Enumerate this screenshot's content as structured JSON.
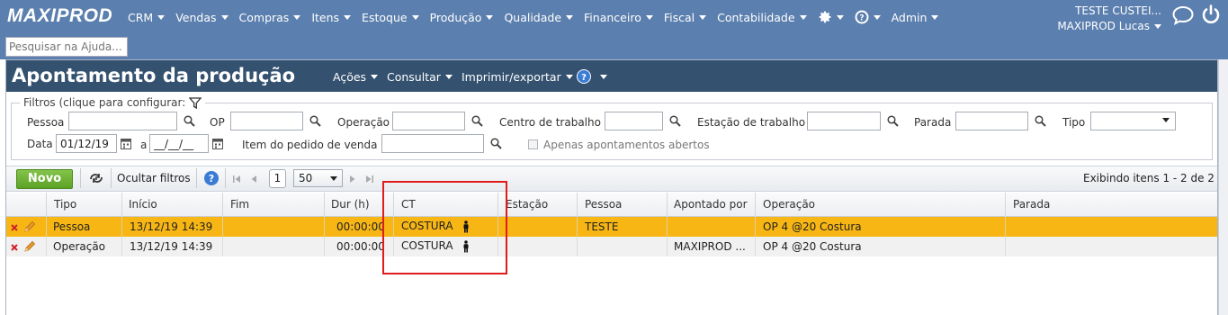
{
  "app": {
    "logo": "MAXIPROD",
    "nav": [
      "CRM",
      "Vendas",
      "Compras",
      "Itens",
      "Estoque",
      "Produção",
      "Qualidade",
      "Financeiro",
      "Fiscal",
      "Contabilidade",
      "Admin"
    ],
    "company": "TESTE CUSTEI...",
    "user": "MAXIPROD Lucas",
    "help_search_placeholder": "Pesquisar na Ajuda..."
  },
  "page": {
    "title": "Apontamento da produção",
    "menus": [
      "Ações",
      "Consultar",
      "Imprimir/exportar"
    ]
  },
  "filters": {
    "legend": "Filtros (clique para configurar:",
    "pessoa_label": "Pessoa",
    "op_label": "OP",
    "operacao_label": "Operação",
    "centro_label": "Centro de trabalho",
    "estacao_label": "Estação de trabalho",
    "parada_label": "Parada",
    "tipo_label": "Tipo",
    "data_label": "Data",
    "data_from": "01/12/19",
    "data_sep": "a",
    "data_to": "__/__/__",
    "item_label": "Item do pedido de venda",
    "apenas_label": "Apenas apontamentos abertos"
  },
  "toolbar": {
    "novo": "Novo",
    "ocultar": "Ocultar filtros",
    "page": "1",
    "page_size": "50",
    "summary": "Exibindo itens 1 - 2 de 2"
  },
  "grid": {
    "columns": [
      "Tipo",
      "Início",
      "Fim",
      "Dur (h)",
      "CT",
      "Estação",
      "Pessoa",
      "Apontado por",
      "Operação",
      "Parada"
    ],
    "rows": [
      {
        "tipo": "Pessoa",
        "inicio": "13/12/19 14:39",
        "fim": "",
        "dur": "00:00:00",
        "ct": "COSTURA",
        "estacao": "",
        "pessoa": "TESTE",
        "apontado": "",
        "operacao": "OP 4 @20 Costura",
        "parada": ""
      },
      {
        "tipo": "Operação",
        "inicio": "13/12/19 14:39",
        "fim": "",
        "dur": "00:00:00",
        "ct": "COSTURA",
        "estacao": "",
        "pessoa": "",
        "apontado": "MAXIPROD ...",
        "operacao": "OP 4 @20 Costura",
        "parada": ""
      }
    ]
  },
  "colors": {
    "topbar": "#5b7fae",
    "titlebar": "#34516f",
    "selected_row": "#f7b614",
    "novo_button": "#6fb336",
    "highlight_box": "#e01b1b"
  }
}
